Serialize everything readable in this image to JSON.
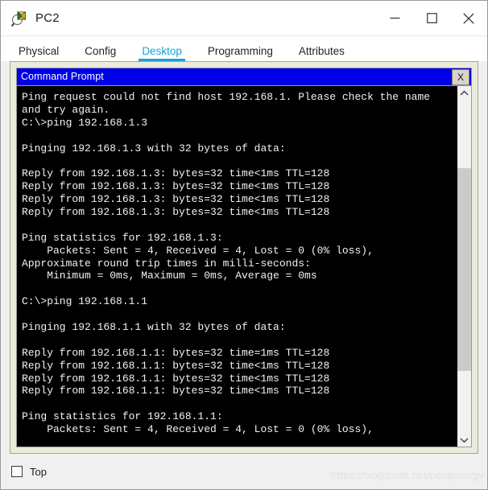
{
  "window": {
    "title": "PC2",
    "icon": "pc-inspect-icon",
    "controls": {
      "minimize": "—",
      "maximize": "□",
      "close": "✕"
    }
  },
  "tabs": [
    {
      "label": "Physical",
      "active": false
    },
    {
      "label": "Config",
      "active": false
    },
    {
      "label": "Desktop",
      "active": true
    },
    {
      "label": "Programming",
      "active": false
    },
    {
      "label": "Attributes",
      "active": false
    }
  ],
  "command_prompt": {
    "title": "Command Prompt",
    "close_label": "X",
    "lines": [
      "Ping request could not find host 192.168.1. Please check the name",
      "and try again.",
      "C:\\>ping 192.168.1.3",
      "",
      "Pinging 192.168.1.3 with 32 bytes of data:",
      "",
      "Reply from 192.168.1.3: bytes=32 time<1ms TTL=128",
      "Reply from 192.168.1.3: bytes=32 time<1ms TTL=128",
      "Reply from 192.168.1.3: bytes=32 time<1ms TTL=128",
      "Reply from 192.168.1.3: bytes=32 time<1ms TTL=128",
      "",
      "Ping statistics for 192.168.1.3:",
      "    Packets: Sent = 4, Received = 4, Lost = 0 (0% loss),",
      "Approximate round trip times in milli-seconds:",
      "    Minimum = 0ms, Maximum = 0ms, Average = 0ms",
      "",
      "C:\\>ping 192.168.1.1",
      "",
      "Pinging 192.168.1.1 with 32 bytes of data:",
      "",
      "Reply from 192.168.1.1: bytes=32 time=1ms TTL=128",
      "Reply from 192.168.1.1: bytes=32 time<1ms TTL=128",
      "Reply from 192.168.1.1: bytes=32 time<1ms TTL=128",
      "Reply from 192.168.1.1: bytes=32 time<1ms TTL=128",
      "",
      "Ping statistics for 192.168.1.1:",
      "    Packets: Sent = 4, Received = 4, Lost = 0 (0% loss),"
    ],
    "scrollbar": {
      "up_arrow": "⌃",
      "down_arrow": "⌄"
    }
  },
  "footer": {
    "top_label": "Top",
    "top_checked": false,
    "watermark": "https://blog.csdn.net/pengmingjv"
  },
  "colors": {
    "tab_accent": "#17a2d6",
    "cmd_titlebar": "#0000e8",
    "panel_bg": "#eceadb",
    "terminal_bg": "#000000",
    "terminal_fg": "#f2f2f2"
  }
}
